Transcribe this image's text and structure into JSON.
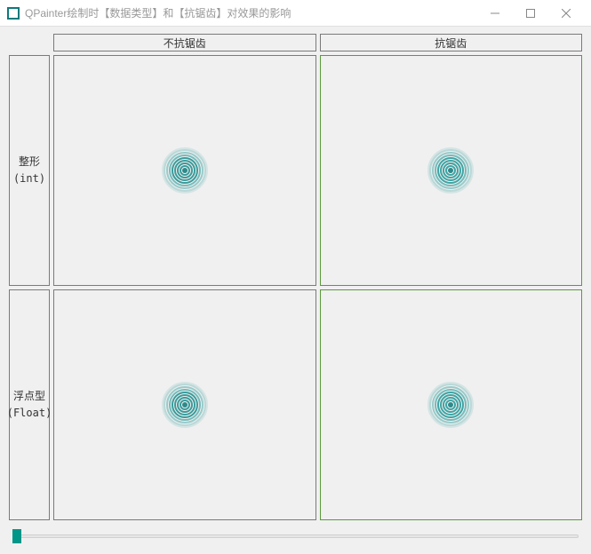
{
  "window": {
    "title": "QPainter绘制时【数据类型】和【抗锯齿】对效果的影响"
  },
  "headers": {
    "col1": "不抗锯齿",
    "col2": "抗锯齿"
  },
  "rows": {
    "r1_line1": "整形",
    "r1_line2": "(int)",
    "r2_line1": "浮点型",
    "r2_line2": "(Float)"
  },
  "slider": {
    "min": 0,
    "max": 100,
    "value": 0
  }
}
